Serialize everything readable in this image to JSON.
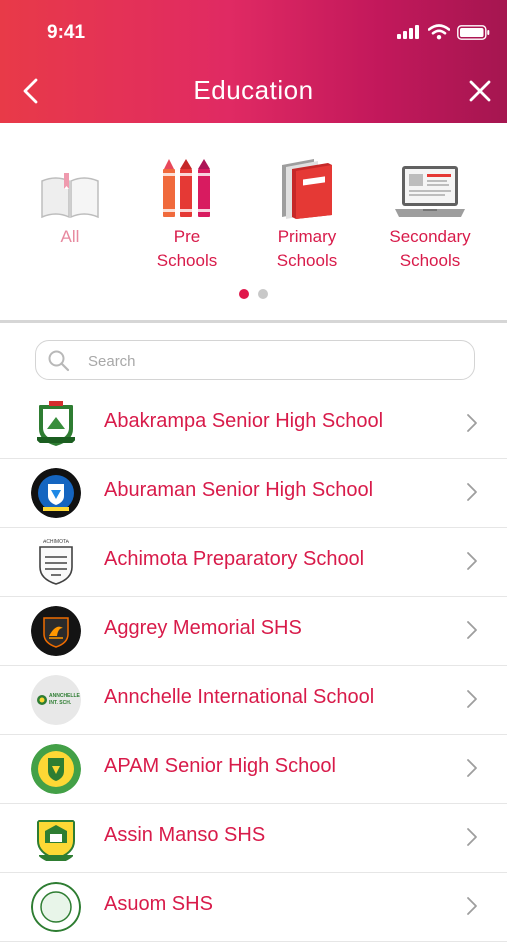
{
  "status_bar": {
    "time": "9:41"
  },
  "header": {
    "title": "Education"
  },
  "categories": [
    {
      "label_line1": "All",
      "label_line2": "",
      "icon": "book-icon"
    },
    {
      "label_line1": "Pre",
      "label_line2": "Schools",
      "icon": "crayons-icon"
    },
    {
      "label_line1": "Primary",
      "label_line2": "Schools",
      "icon": "books-icon"
    },
    {
      "label_line1": "Secondary",
      "label_line2": "Schools",
      "icon": "laptop-icon"
    }
  ],
  "pager": {
    "current": 1,
    "total": 2
  },
  "search": {
    "placeholder": "Search",
    "value": ""
  },
  "schools": [
    {
      "name": "Abakrampa Senior High School",
      "logo": "crest-icon"
    },
    {
      "name": "Aburaman Senior High School",
      "logo": "crest-icon"
    },
    {
      "name": "Achimota Preparatory School",
      "logo": "crest-icon",
      "logo_text": "ACHIMOTA"
    },
    {
      "name": "Aggrey Memorial SHS",
      "logo": "crest-icon"
    },
    {
      "name": "Annchelle International School",
      "logo": "crest-icon",
      "logo_text": "ANNCHELLE INT. SCH."
    },
    {
      "name": "APAM Senior High School",
      "logo": "crest-icon"
    },
    {
      "name": "Assin Manso SHS",
      "logo": "crest-icon"
    },
    {
      "name": "Asuom SHS",
      "logo": "crest-icon"
    }
  ],
  "colors": {
    "accent": "#d81b4a",
    "header_start": "#e83a48",
    "header_end": "#a51650"
  }
}
